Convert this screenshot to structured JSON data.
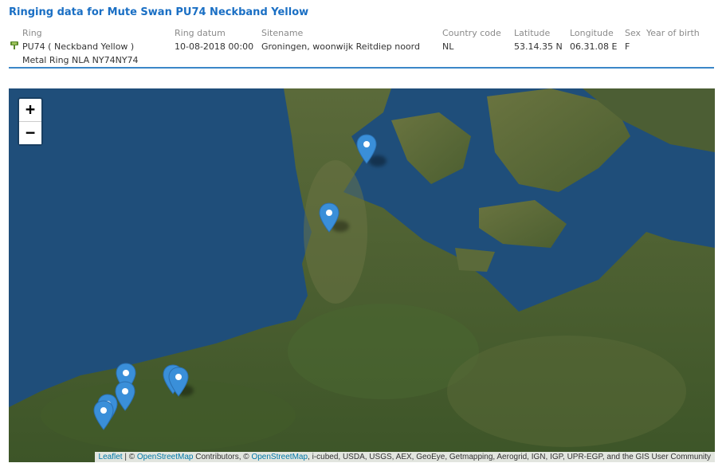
{
  "title": "Ringing data for Mute Swan PU74 Neckband Yellow",
  "columns": {
    "ring": "Ring",
    "ring_datum": "Ring datum",
    "sitename": "Sitename",
    "country_code": "Country code",
    "latitude": "Latitude",
    "longitude": "Longitude",
    "sex": "Sex",
    "year_of_birth": "Year of birth"
  },
  "record": {
    "ring": "PU74 ( Neckband Yellow )",
    "ring_secondary": "Metal Ring NLA NY74NY74",
    "ring_datum": "10-08-2018 00:00",
    "sitename": "Groningen, woonwijk Reitdiep noord",
    "country_code": "NL",
    "latitude": "53.14.35 N",
    "longitude": "06.31.08 E",
    "sex": "F",
    "year_of_birth": ""
  },
  "map": {
    "zoom_in": "+",
    "zoom_out": "−",
    "attribution_leaflet": "Leaflet",
    "attribution_sep1": " | © ",
    "attribution_osm1": "OpenStreetMap",
    "attribution_mid": " Contributors, © ",
    "attribution_osm2": "OpenStreetMap",
    "attribution_rest": ", i-cubed, USDA, USGS, AEX, GeoEye, Getmapping, Aerogrid, IGN, IGP, UPR-EGP, and the GIS User Community",
    "marker_color": "#3a8fd9",
    "water_color": "#1f4e7a",
    "land_color": "#3f5a2c"
  }
}
